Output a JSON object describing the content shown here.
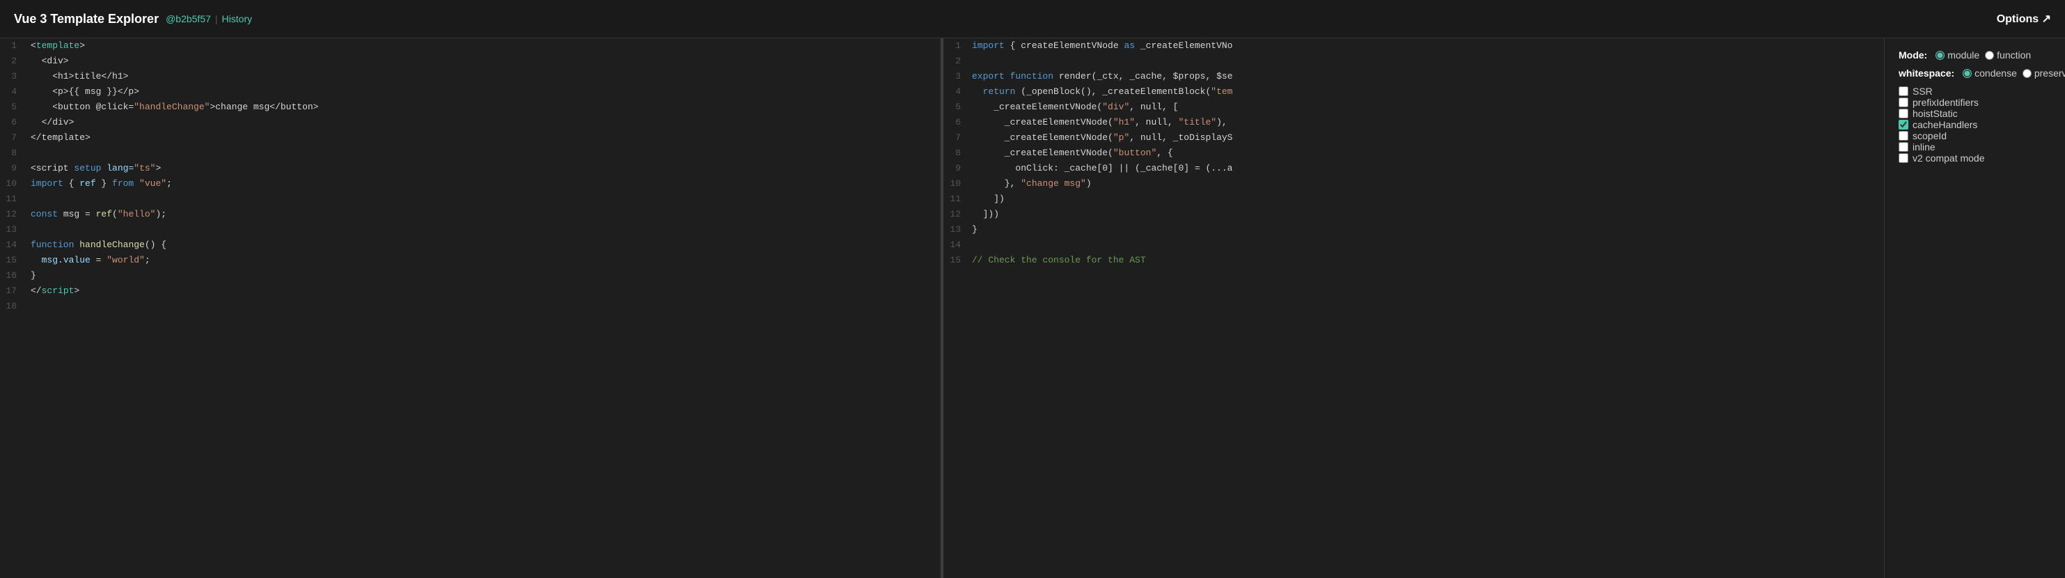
{
  "header": {
    "title": "Vue 3 Template Explorer",
    "commit_text": "@b2b5f57",
    "separator": "|",
    "history_label": "History",
    "options_label": "Options ↗"
  },
  "left_editor": {
    "lines": [
      {
        "num": 1,
        "tokens": [
          {
            "t": "<",
            "c": "punct"
          },
          {
            "t": "template",
            "c": "tag"
          },
          {
            "t": ">",
            "c": "punct"
          }
        ],
        "error": false
      },
      {
        "num": 2,
        "tokens": [
          {
            "t": "  <div>",
            "c": "punct"
          }
        ],
        "error": false
      },
      {
        "num": 3,
        "tokens": [
          {
            "t": "    <h1>title</h1>",
            "c": "punct"
          }
        ],
        "error": false
      },
      {
        "num": 4,
        "tokens": [
          {
            "t": "    <p>{{ msg }}</p>",
            "c": "punct"
          }
        ],
        "error": false
      },
      {
        "num": 5,
        "tokens": [
          {
            "t": "    <button @click=",
            "c": "punct"
          },
          {
            "t": "\"handleChange\"",
            "c": "str"
          },
          {
            "t": ">change msg</button>",
            "c": "punct"
          }
        ],
        "error": false
      },
      {
        "num": 6,
        "tokens": [
          {
            "t": "  </div>",
            "c": "punct"
          }
        ],
        "error": false
      },
      {
        "num": 7,
        "tokens": [
          {
            "t": "</template>",
            "c": "punct"
          }
        ],
        "error": false
      },
      {
        "num": 8,
        "tokens": [],
        "error": false
      },
      {
        "num": 9,
        "tokens": [
          {
            "t": "<script ",
            "c": "punct"
          },
          {
            "t": "setup ",
            "c": "kw"
          },
          {
            "t": "lang=",
            "c": "attr"
          },
          {
            "t": "\"ts\"",
            "c": "str"
          },
          {
            "t": ">",
            "c": "punct"
          }
        ],
        "error": false
      },
      {
        "num": 10,
        "tokens": [
          {
            "t": "import",
            "c": "kw"
          },
          {
            "t": " { ",
            "c": "punct"
          },
          {
            "t": "ref",
            "c": "var"
          },
          {
            "t": " } ",
            "c": "punct"
          },
          {
            "t": "from ",
            "c": "kw"
          },
          {
            "t": "\"vue\"",
            "c": "str"
          },
          {
            "t": ";",
            "c": "punct"
          }
        ],
        "error": true
      },
      {
        "num": 11,
        "tokens": [],
        "error": false
      },
      {
        "num": 12,
        "tokens": [
          {
            "t": "const",
            "c": "kw"
          },
          {
            "t": " msg = ",
            "c": "punct"
          },
          {
            "t": "ref",
            "c": "fn"
          },
          {
            "t": "(",
            "c": "punct"
          },
          {
            "t": "\"hello\"",
            "c": "str"
          },
          {
            "t": ");",
            "c": "punct"
          }
        ],
        "error": true
      },
      {
        "num": 13,
        "tokens": [],
        "error": false
      },
      {
        "num": 14,
        "tokens": [
          {
            "t": "function",
            "c": "kw"
          },
          {
            "t": " ",
            "c": "punct"
          },
          {
            "t": "handleChange",
            "c": "fn"
          },
          {
            "t": "() {",
            "c": "punct"
          }
        ],
        "error": false
      },
      {
        "num": 15,
        "tokens": [
          {
            "t": "  msg",
            "c": "var"
          },
          {
            "t": ".",
            "c": "punct"
          },
          {
            "t": "value",
            "c": "var"
          },
          {
            "t": " = ",
            "c": "punct"
          },
          {
            "t": "\"world\"",
            "c": "str"
          },
          {
            "t": ";",
            "c": "punct"
          }
        ],
        "error": true
      },
      {
        "num": 16,
        "tokens": [
          {
            "t": "}",
            "c": "punct"
          }
        ],
        "error": false
      },
      {
        "num": 17,
        "tokens": [
          {
            "t": "</",
            "c": "punct"
          },
          {
            "t": "script",
            "c": "tag"
          },
          {
            "t": ">",
            "c": "punct"
          }
        ],
        "error": true
      },
      {
        "num": 18,
        "tokens": [],
        "error": false
      }
    ]
  },
  "right_editor": {
    "lines": [
      {
        "num": 1,
        "text": "import { createElementVNode as _createElementVNo"
      },
      {
        "num": 2,
        "text": ""
      },
      {
        "num": 3,
        "text": "export function render(_ctx, _cache, $props, $se"
      },
      {
        "num": 4,
        "text": "  return (_openBlock(), _createElementBlock(\"tem"
      },
      {
        "num": 5,
        "text": "    _createElementVNode(\"div\", null, ["
      },
      {
        "num": 6,
        "text": "      _createElementVNode(\"h1\", null, \"title\"),"
      },
      {
        "num": 7,
        "text": "      _createElementVNode(\"p\", null, _toDisplayS"
      },
      {
        "num": 8,
        "text": "      _createElementVNode(\"button\", {"
      },
      {
        "num": 9,
        "text": "        onClick: _cache[0] || (_cache[0] = (...a"
      },
      {
        "num": 10,
        "text": "      }, \"change msg\")"
      },
      {
        "num": 11,
        "text": "    ])"
      },
      {
        "num": 12,
        "text": "  ]))"
      },
      {
        "num": 13,
        "text": "}"
      },
      {
        "num": 14,
        "text": ""
      },
      {
        "num": 15,
        "text": "// Check the console for the AST"
      }
    ]
  },
  "options": {
    "mode_label": "Mode:",
    "mode_options": [
      {
        "label": "module",
        "checked": true
      },
      {
        "label": "function",
        "checked": false
      }
    ],
    "whitespace_label": "whitespace:",
    "whitespace_options": [
      {
        "label": "condense",
        "checked": true
      },
      {
        "label": "preserve",
        "checked": false
      }
    ],
    "checkboxes": [
      {
        "label": "SSR",
        "checked": false
      },
      {
        "label": "prefixIdentifiers",
        "checked": false
      },
      {
        "label": "hoistStatic",
        "checked": false
      },
      {
        "label": "cacheHandlers",
        "checked": true
      },
      {
        "label": "scopeId",
        "checked": false
      },
      {
        "label": "inline",
        "checked": false
      },
      {
        "label": "v2 compat mode",
        "checked": false
      }
    ]
  }
}
